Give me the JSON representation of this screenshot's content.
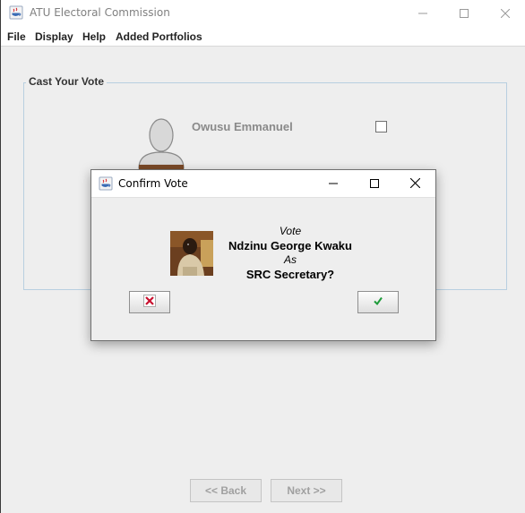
{
  "window": {
    "title": "ATU Electoral Commission",
    "icons": {
      "app": "java-coffee-icon",
      "minimize": "minimize-icon",
      "maximize": "maximize-icon",
      "close": "close-icon"
    }
  },
  "menu": {
    "items": [
      "File",
      "Display",
      "Help",
      "Added Portfolios"
    ]
  },
  "panel": {
    "group_title": "Cast Your Vote",
    "candidate": {
      "name": "Owusu Emmanuel",
      "checked": false,
      "avatar_icon": "user-placeholder-icon"
    }
  },
  "navigation": {
    "back_label": "<< Back",
    "next_label": "Next >>"
  },
  "dialog": {
    "title": "Confirm Vote",
    "line1": "Vote",
    "candidate_name": "Ndzinu George Kwaku",
    "line3": "As",
    "portfolio": "SRC Secretary?",
    "cancel_icon": "red-x-icon",
    "confirm_icon": "green-check-icon"
  },
  "colors": {
    "cancel": "#c8102e",
    "confirm": "#1e9b3a",
    "group_border": "#b8cfe0"
  }
}
